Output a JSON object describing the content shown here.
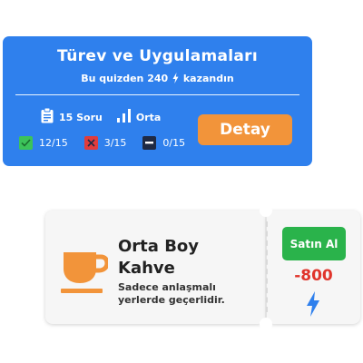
{
  "quiz": {
    "title": "Türev ve Uygulamaları",
    "subtitle_prefix": "Bu quizden",
    "reward_amount": "240",
    "subtitle_suffix": "kazandın",
    "question_count": "15 Soru",
    "difficulty": "Orta",
    "correct": "12/15",
    "wrong": "3/15",
    "empty": "0/15",
    "detail_button": "Detay",
    "colors": {
      "card": "#2f80ed",
      "button": "#f2943a",
      "correct": "#3cc35a",
      "wrong": "#e03c3c",
      "empty": "#1f2a44"
    },
    "icons": [
      "clipboard-icon",
      "signal-bars-icon",
      "lightning-icon",
      "check-icon",
      "cross-icon",
      "minus-icon"
    ]
  },
  "coupon": {
    "title": "Orta Boy Kahve",
    "description": "Sadece anlaşmalı yerlerde geçerlidir.",
    "buy_button": "Satın Al",
    "price": "-800",
    "colors": {
      "icon": "#f2943a",
      "buy": "#2ab34b",
      "price": "#e0342b",
      "bolt": "#2f80ed"
    },
    "icons": [
      "coffee-cup-icon",
      "lightning-icon"
    ]
  }
}
